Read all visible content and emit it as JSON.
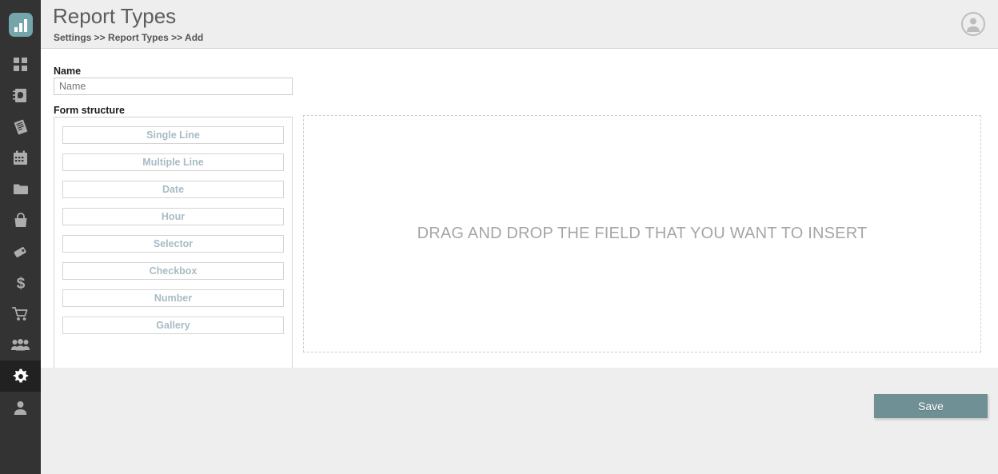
{
  "sidebar": {
    "logo": {
      "name": "app-logo-bar-chart"
    },
    "items": [
      {
        "icon": "grid-dashboard-icon",
        "name": "sidebar-item-dashboard",
        "active": false
      },
      {
        "icon": "contacts-book-icon",
        "name": "sidebar-item-contacts",
        "active": false
      },
      {
        "icon": "invoice-document-icon",
        "name": "sidebar-item-invoices",
        "active": false
      },
      {
        "icon": "calendar-icon",
        "name": "sidebar-item-calendar",
        "active": false
      },
      {
        "icon": "folder-icon",
        "name": "sidebar-item-files",
        "active": false
      },
      {
        "icon": "shopping-bag-icon",
        "name": "sidebar-item-products",
        "active": false
      },
      {
        "icon": "tag-icon",
        "name": "sidebar-item-tags",
        "active": false
      },
      {
        "icon": "dollar-icon",
        "name": "sidebar-item-finance",
        "active": false
      },
      {
        "icon": "shopping-cart-icon",
        "name": "sidebar-item-orders",
        "active": false
      },
      {
        "icon": "users-group-icon",
        "name": "sidebar-item-customers",
        "active": false
      },
      {
        "icon": "gear-icon",
        "name": "sidebar-item-settings",
        "active": true
      },
      {
        "icon": "user-icon",
        "name": "sidebar-item-account",
        "active": false
      }
    ]
  },
  "header": {
    "title": "Report Types",
    "breadcrumb": "Settings >> Report Types >> Add",
    "avatar_icon": "user-avatar-icon"
  },
  "form": {
    "name_label": "Name",
    "name_value": "",
    "name_placeholder": "Name",
    "structure_label": "Form structure",
    "field_types": [
      "Single Line",
      "Multiple Line",
      "Date",
      "Hour",
      "Selector",
      "Checkbox",
      "Number",
      "Gallery"
    ],
    "dropzone_text": "DRAG AND DROP THE FIELD THAT YOU WANT TO INSERT"
  },
  "footer": {
    "save_label": "Save"
  },
  "colors": {
    "sidebar_bg": "#333333",
    "sidebar_active_bg": "#212121",
    "header_bg": "#eeeeee",
    "accent_teal": "#74a5ab",
    "save_button_bg": "#6f9095",
    "field_label": "#a8bcc4",
    "dropzone_text": "#a6a6a6"
  }
}
